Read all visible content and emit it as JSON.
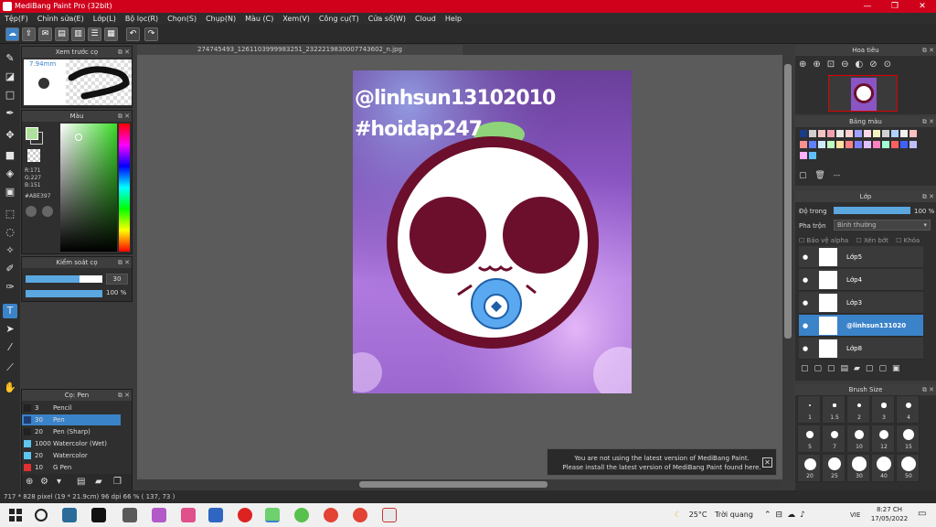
{
  "app": {
    "title": "MediBang Paint Pro (32bit)"
  },
  "menu": [
    "Tệp(F)",
    "Chỉnh sửa(E)",
    "Lớp(L)",
    "Bộ lọc(R)",
    "Chọn(S)",
    "Chụp(N)",
    "Màu (C)",
    "Xem(V)",
    "Công cụ(T)",
    "Cửa sổ(W)",
    "Cloud",
    "Help"
  ],
  "document": {
    "tab": "274745493_1261103999983251_2322219830007743602_n.jpg",
    "text1": "@linhsun13102010",
    "text2": "#hoidap247"
  },
  "preview_panel": {
    "title": "Xem trước cọ",
    "size": "7.94mm"
  },
  "color_panel": {
    "title": "Màu",
    "r": "R:171",
    "g": "G:227",
    "b": "B:151",
    "hex": "#ABE397"
  },
  "brush_control": {
    "title": "Kiểm soát cọ",
    "size": "30",
    "opacity": "100 %"
  },
  "brush_list": {
    "title": "Cọ: Pen",
    "items": [
      {
        "size": "3",
        "name": "Pencil",
        "color": "#222222"
      },
      {
        "size": "30",
        "name": "Pen",
        "color": "#1f3c72"
      },
      {
        "size": "20",
        "name": "Pen (Sharp)",
        "color": "#222222"
      },
      {
        "size": "1000",
        "name": "Watercolor (Wet)",
        "color": "#5fc6f0"
      },
      {
        "size": "20",
        "name": "Watercolor",
        "color": "#5fc6f0"
      },
      {
        "size": "10",
        "name": "G Pen",
        "color": "#e03030"
      }
    ]
  },
  "navigator": {
    "title": "Hoa tiêu"
  },
  "palette": {
    "title": "Bảng màu",
    "footer": "---"
  },
  "layers": {
    "title": "Lớp",
    "opacity_label": "Độ trong",
    "opacity_value": "100 %",
    "blend_label": "Pha trộn",
    "blend_value": "Bình thường",
    "protect_alpha": "Bảo vệ alpha",
    "clipping": "Xén bớt",
    "lock": "Khóa",
    "items": [
      {
        "name": "Lớp5",
        "active": false
      },
      {
        "name": "Lớp4",
        "active": false
      },
      {
        "name": "Lớp3",
        "active": false
      },
      {
        "name": "@linhsun131020",
        "active": true
      },
      {
        "name": "Lớp8",
        "active": false
      }
    ]
  },
  "brush_size": {
    "title": "Brush Size",
    "labels": [
      "1",
      "1.5",
      "2",
      "3",
      "4",
      "5",
      "7",
      "10",
      "12",
      "15",
      "20",
      "25",
      "30",
      "40",
      "50"
    ]
  },
  "notice": {
    "line1": "You are not using the latest version of MediBang Paint.",
    "line2": "Please install the latest version of MediBang Paint found here."
  },
  "status": {
    "text": "717 * 828 pixel   (19 * 21.9cm)   96 dpi   66 %   ( 137, 73 )"
  },
  "taskbar": {
    "weather_temp": "25°C",
    "weather_desc": "Trời quang",
    "lang": "VIE",
    "time": "8:27 CH",
    "date": "17/05/2022"
  }
}
